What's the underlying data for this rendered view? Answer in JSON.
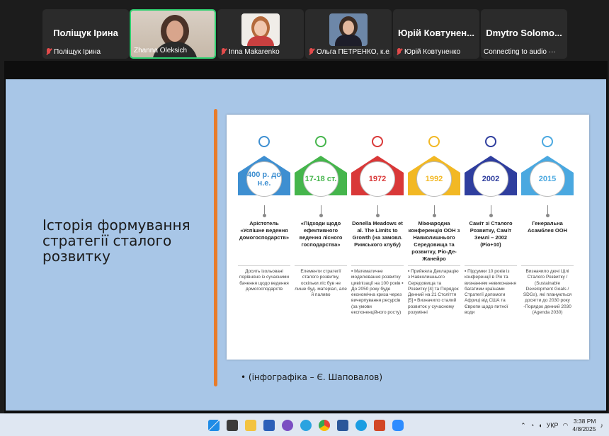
{
  "participants": [
    {
      "big_name": "Поліщук Ірина",
      "label": "Поліщук Ірина",
      "muted": true,
      "video": false
    },
    {
      "big_name": "",
      "label": "Zhanna Oleksich",
      "muted": false,
      "video": true,
      "active": true
    },
    {
      "big_name": "",
      "label": "Inna Makarenko",
      "muted": true,
      "video": true
    },
    {
      "big_name": "",
      "label": "Ольга ПЕТРЕНКО, к.е...",
      "muted": true,
      "video": true
    },
    {
      "big_name": "Юрій Ковтунен...",
      "label": "Юрій Ковтуненко",
      "muted": true,
      "video": false
    },
    {
      "big_name": "Dmytro Solomo...",
      "label": "Connecting to audio ···",
      "muted": false,
      "video": false
    }
  ],
  "slide": {
    "title": "Історія формування стратегії сталого розвитку",
    "caption": "•   (інфографіка – Є. Шаповалов)",
    "columns": [
      {
        "color": "#3e8fd1",
        "icon": "location-pin-icon",
        "year": "400 р. до н.е.",
        "head": "Арістотель «Успішне ведення домогосподарств»",
        "body": "Досить ізольовані порівняно із сучасними бачення щодо ведення домогосподарств",
        "align": "center"
      },
      {
        "color": "#45b54c",
        "icon": "lightbulb-icon",
        "year": "17-18 ст.",
        "head": "«Підходи щодо ефективного ведення лісного господарства»",
        "body": "Елементи стратегії сталого розвитку, оскільки ліс був не лише буд. матеріал, але й паливо",
        "align": "center"
      },
      {
        "color": "#d93838",
        "icon": "tools-icon",
        "year": "1972",
        "head": "Donella Meadows et al. The Limits to Growth (на замовл. Римського клубу)",
        "body": "▪ Математичне моделювання розвитку цивілізації на 100 років ▪ До 2050 року буде економічна криза через вичерпування ресурсів (за умови експоненційного росту)",
        "align": "left"
      },
      {
        "color": "#f2b824",
        "icon": "hand-icon",
        "year": "1992",
        "head": "Міжнародна конференція ООН з Навколишнього Середовища та розвитку, Ріо-Де-Жанейро",
        "body": "▪ Прийняла Декларацію з Навколишнього Середовища та Розвитку [4] та Порядок Денний на 21 Століття [5] ▪ Визначило сталий розвиток у сучасному розумінні",
        "align": "left"
      },
      {
        "color": "#2f3e9e",
        "icon": "people-icon",
        "year": "2002",
        "head": "Саміт зі Сталого Розвитку, Саміт Землі – 2002 (Ріо+10)",
        "body": "▪ Підсумки 10 років із конференції в Ріо та визнанням невиконання багатими країнами Стратегії допомоги Африці від США та Європи щодо питної води",
        "align": "left"
      },
      {
        "color": "#4aa8e0",
        "icon": "gear-icon",
        "year": "2015",
        "head": "Генеральна Асамблея ООН",
        "body": "Визначило дючі Цілі Сталого Розвитку / (Sustainable Development Goals / SDGs), які плануються досягти до 2030 року -Порядок денний 2030 (Agenda 2030)",
        "align": "center"
      }
    ]
  },
  "tray": {
    "lang": "УКР",
    "time": "3:38 PM",
    "date": "4/8/2025"
  }
}
